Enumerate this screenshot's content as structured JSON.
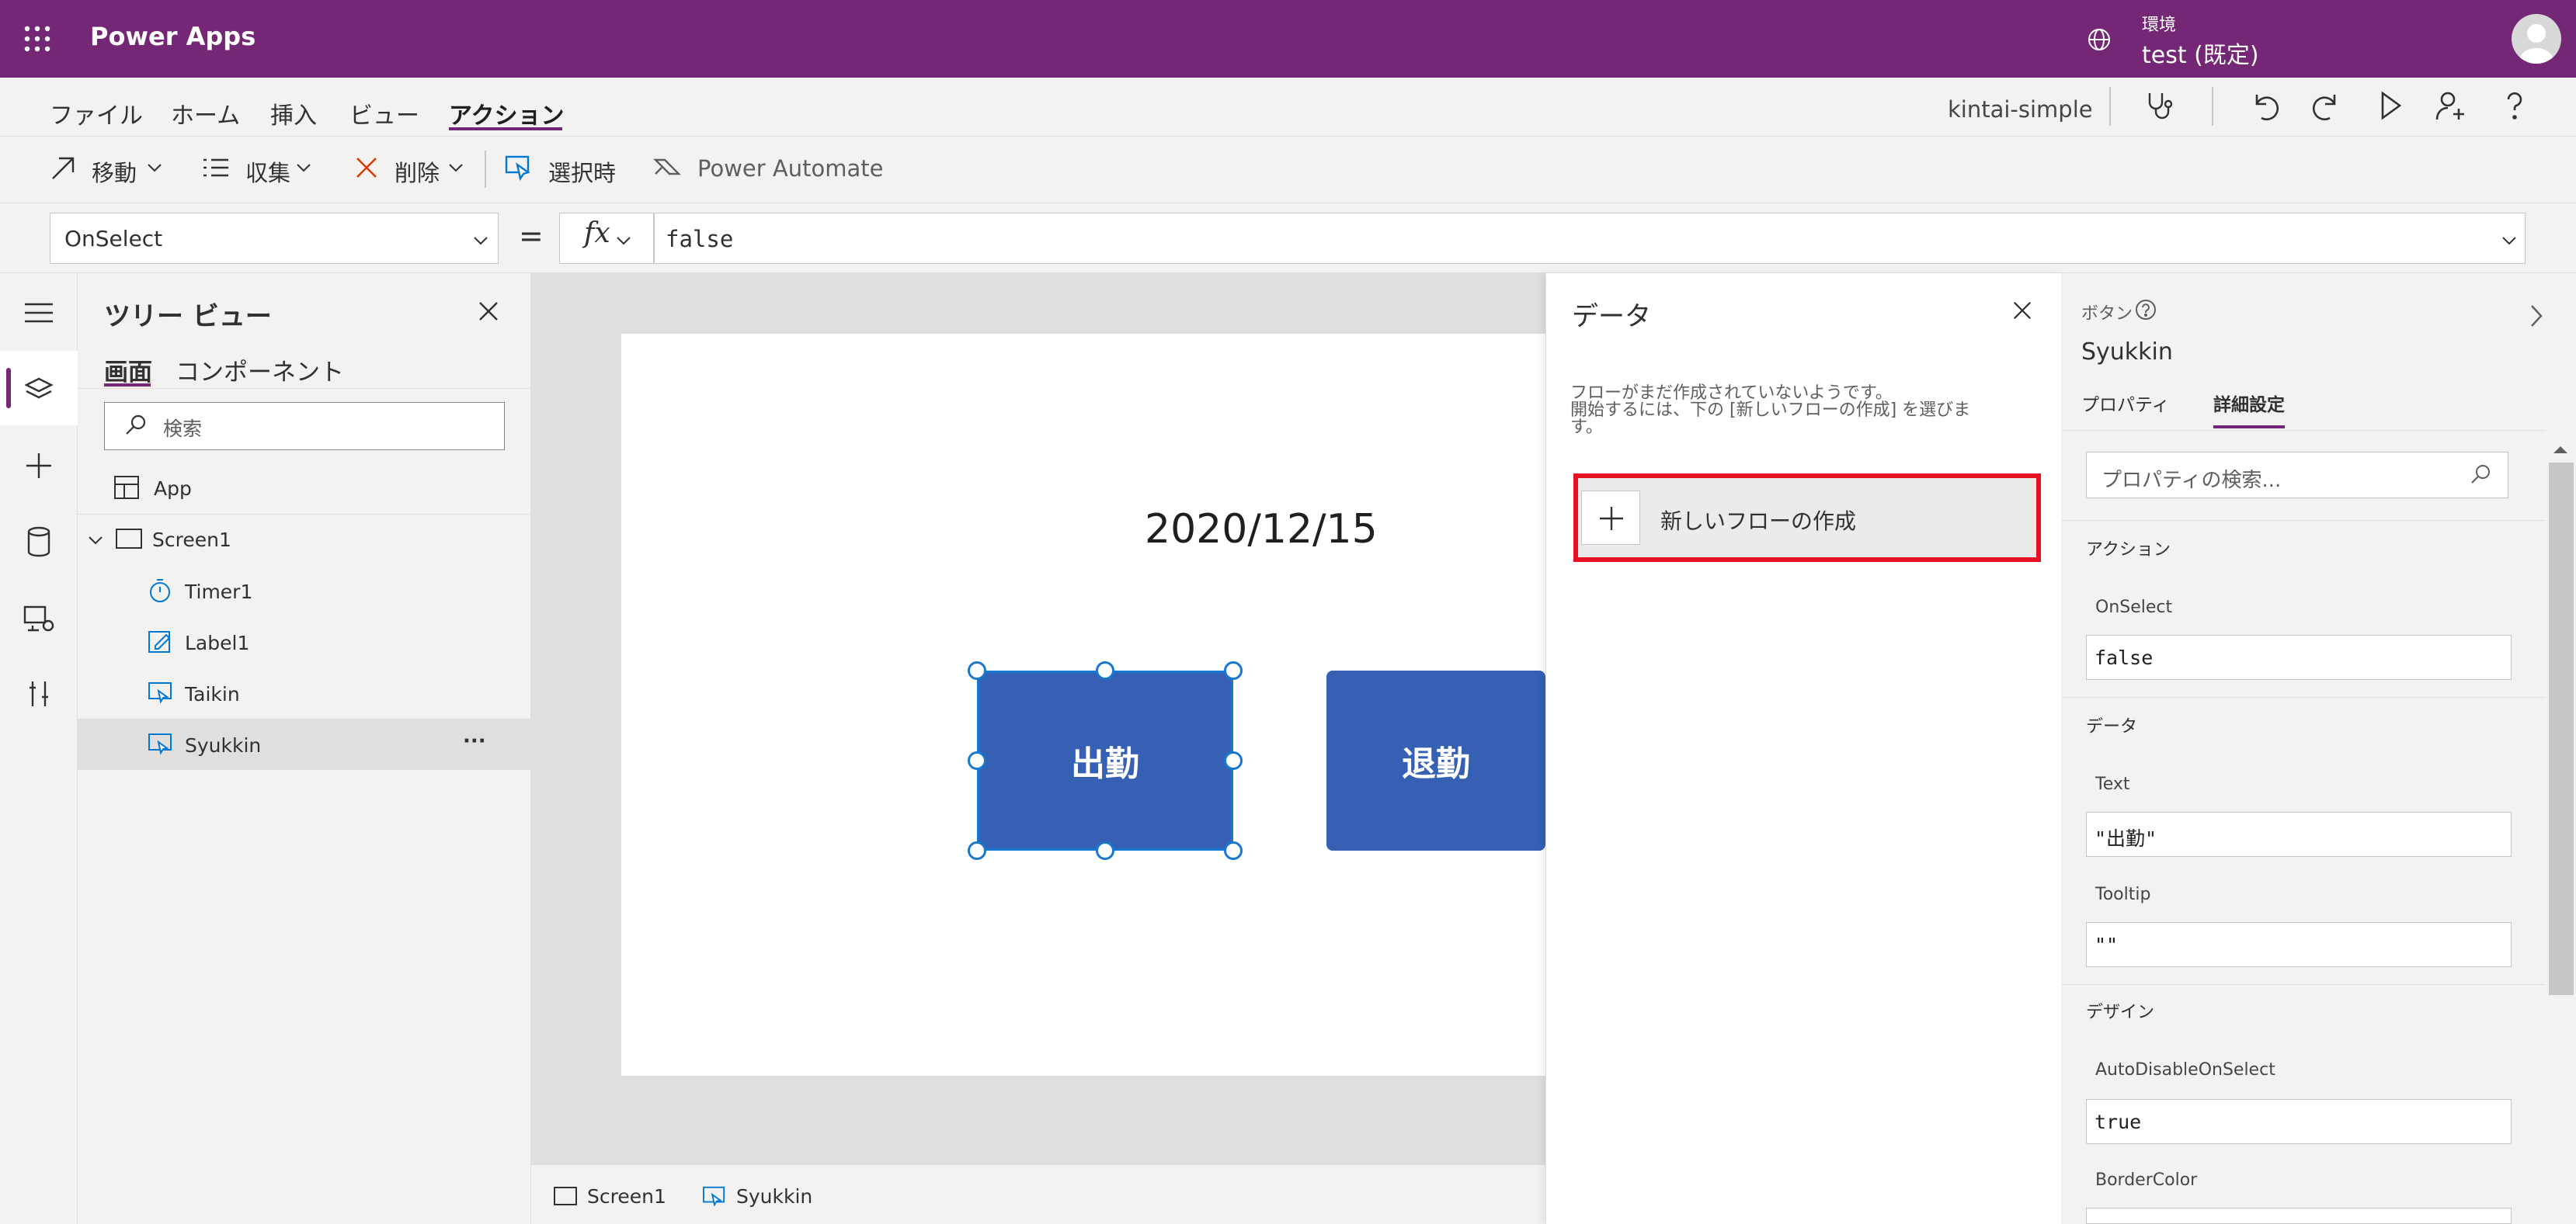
{
  "app": {
    "brand": "Power Apps"
  },
  "environment": {
    "label": "環境",
    "name": "test (既定)"
  },
  "menu": {
    "items": [
      "ファイル",
      "ホーム",
      "挿入",
      "ビュー",
      "アクション"
    ],
    "active_index": 4,
    "app_name": "kintai-simple"
  },
  "toolbar": {
    "move": "移動",
    "collect": "収集",
    "remove": "削除",
    "onselect": "選択時",
    "power_automate": "Power Automate"
  },
  "formula_bar": {
    "property": "OnSelect",
    "equals": "=",
    "fx": "fx",
    "formula": "false"
  },
  "tree_view": {
    "title": "ツリー ビュー",
    "tabs": [
      "画面",
      "コンポーネント"
    ],
    "search_placeholder": "検索",
    "app_node": "App",
    "screen_node": "Screen1",
    "children": [
      "Timer1",
      "Label1",
      "Taikin",
      "Syukkin"
    ],
    "more": "···"
  },
  "canvas": {
    "date_label": "2020/12/15",
    "button_selected": "出勤",
    "button_other": "退勤"
  },
  "status_bar": {
    "screen": "Screen1",
    "control": "Syukkin"
  },
  "data_panel": {
    "title": "データ",
    "message_line1": "フローがまだ作成されていないようです。",
    "message_line2": "開始するには、下の [新しいフローの作成] を選びま",
    "message_line3": "す。",
    "new_flow_button": "新しいフローの作成"
  },
  "properties": {
    "control_type": "ボタン",
    "control_name": "Syukkin",
    "tabs": [
      "プロパティ",
      "詳細設定"
    ],
    "active_tab_index": 1,
    "search_placeholder": "プロパティの検索...",
    "sections": {
      "action": "アクション",
      "data": "データ",
      "design": "デザイン"
    },
    "fields": {
      "onselect_label": "OnSelect",
      "onselect_value": "false",
      "text_label": "Text",
      "text_value": "\"出勤\"",
      "tooltip_label": "Tooltip",
      "tooltip_value": "\"\"",
      "autodisable_label": "AutoDisableOnSelect",
      "autodisable_value": "true",
      "bordercolor_label": "BorderColor"
    }
  },
  "colors": {
    "accent": "#742774",
    "button": "#3560b3",
    "highlight": "#e81123",
    "selection": "#1778d2"
  }
}
